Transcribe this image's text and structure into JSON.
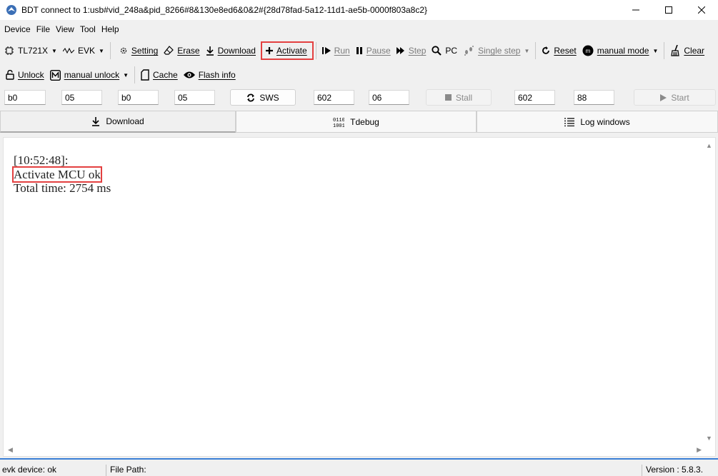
{
  "window": {
    "title": "BDT connect to 1:usb#vid_248a&pid_8266#8&130e8ed6&0&2#{28d78fad-5a12-11d1-ae5b-0000f803a8c2}",
    "controls": {
      "minimize": "minimize-icon",
      "maximize": "maximize-icon",
      "close": "close-icon"
    }
  },
  "menu": [
    "Device",
    "File",
    "View",
    "Tool",
    "Help"
  ],
  "toolbar1": {
    "chip": "TL721X",
    "board": "EVK",
    "setting": "Setting",
    "erase": "Erase",
    "download": "Download",
    "activate": "Activate",
    "run": "Run",
    "pause": "Pause",
    "step": "Step",
    "pc": "PC",
    "single_step": "Single step",
    "reset": "Reset",
    "mode": "manual mode",
    "clear": "Clear"
  },
  "toolbar2": {
    "unlock": "Unlock",
    "manual_unlock": "manual unlock",
    "cache": "Cache",
    "flash_info": "Flash info"
  },
  "registers": {
    "in1": "b0",
    "in2": "05",
    "in3": "b0",
    "in4": "05",
    "sws": "SWS",
    "in5": "602",
    "in6": "06",
    "stall": "Stall",
    "in7": "602",
    "in8": "88",
    "start": "Start"
  },
  "tabs": [
    "Download",
    "Tdebug",
    "Log windows"
  ],
  "log": {
    "timestamp": "[10:52:48]:",
    "message": "Activate MCU ok",
    "total": "Total time: 2754 ms"
  },
  "status": {
    "device": "evk device: ok",
    "file_path": "File Path:",
    "version": "Version : 5.8.3."
  },
  "colors": {
    "highlight": "#e34040",
    "accent_line": "#3a7fd6"
  }
}
